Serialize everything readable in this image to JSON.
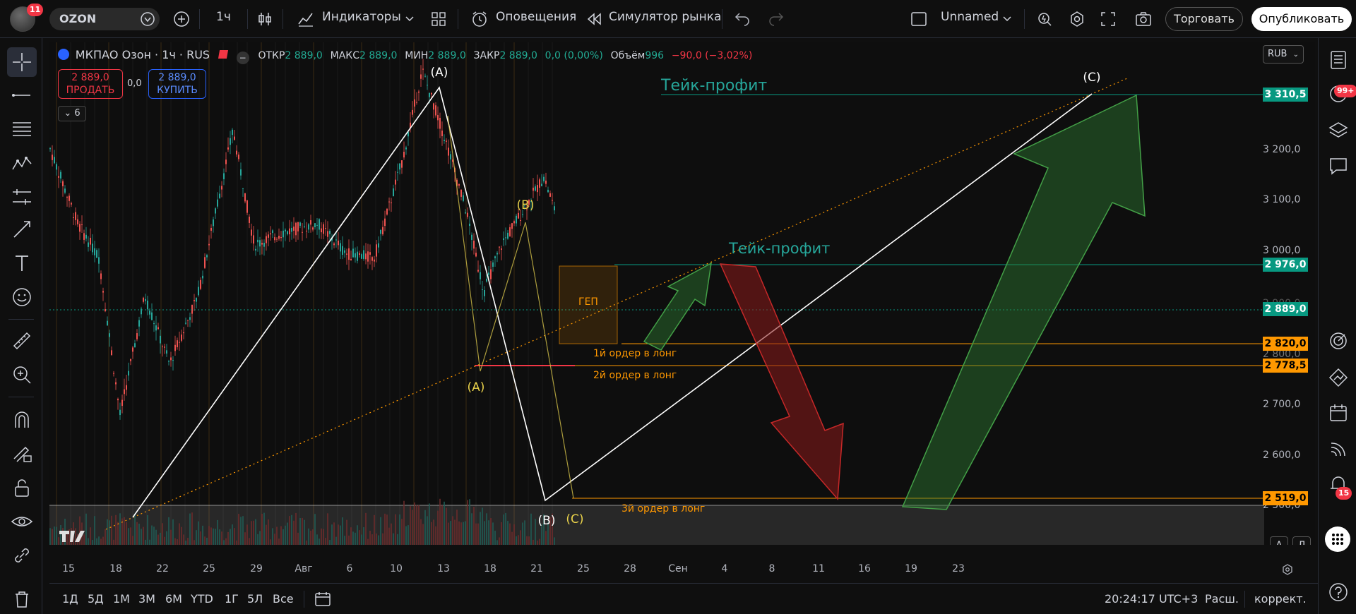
{
  "topbar": {
    "notifications_count": "11",
    "symbol": "OZON",
    "interval": "1ч",
    "indicators_label": "Индикаторы",
    "alerts_label": "Оповещения",
    "replay_label": "Симулятор рынка",
    "layout_name": "Unnamed",
    "trade_button": "Торговать",
    "publish_button": "Опубликовать"
  },
  "legend": {
    "title": "МКПАО Озон · 1ч · RUS",
    "open_label": "ОТКР",
    "open_value": "2 889,0",
    "high_label": "МАКС",
    "high_value": "2 889,0",
    "low_label": "МИН",
    "low_value": "2 889,0",
    "close_label": "ЗАКР",
    "close_value": "2 889,0",
    "change_value": "0,0 (0,00%)",
    "volume_label": "Объём",
    "volume_value": "996",
    "volume_change": "−90,0 (−3,02%)"
  },
  "trade": {
    "sell_price": "2 889,0",
    "sell_label": "ПРОДАТЬ",
    "spread": "0,0",
    "buy_price": "2 889,0",
    "buy_label": "КУПИТЬ"
  },
  "indicator_count": "6",
  "currency": "RUB",
  "price_axis": {
    "ticks": [
      "3 200,0",
      "3 100,0",
      "3 000,0",
      "2 900,0",
      "2 800,0",
      "2 700,0",
      "2 600,0",
      "2 500,0"
    ],
    "tags": {
      "tp_high": "3 310,5",
      "tp_low": "2 976,0",
      "current": "2 889,0",
      "order1": "2 820,0",
      "order2": "2 778,5",
      "order3": "2 519,0"
    },
    "colors": {
      "teal": "#089981",
      "orange": "#ff9800",
      "current": "#089981"
    }
  },
  "annotations": {
    "tp_top": "Тейк-профит",
    "tp_mid": "Тейк-профит",
    "gap": "ГЕП",
    "order1": "1й ордер в лонг",
    "order2": "2й ордер в лонг",
    "order3": "3й ордер в лонг",
    "wave_A_top": "(A)",
    "wave_B_small": "(B)",
    "wave_A_small": "(A)",
    "wave_B_big": "(B)",
    "wave_C_small": "(C)",
    "wave_C_big": "(C)"
  },
  "time_axis": {
    "labels": [
      "15",
      "18",
      "22",
      "25",
      "29",
      "Авг",
      "6",
      "10",
      "13",
      "18",
      "21",
      "25",
      "28",
      "Сен",
      "4",
      "8",
      "11",
      "16",
      "19",
      "23"
    ]
  },
  "right_toolbar": {
    "news_badge": "99+",
    "alerts_badge": "15"
  },
  "bottombar": {
    "ranges": [
      "1Д",
      "5Д",
      "1М",
      "3М",
      "6М",
      "YTD",
      "1Г",
      "5Л",
      "Все"
    ],
    "clock": "20:24:17 UTC+3",
    "session": "Расш.",
    "adjust": "коррект."
  },
  "axis_buttons": {
    "auto": "A",
    "log": "Л"
  }
}
